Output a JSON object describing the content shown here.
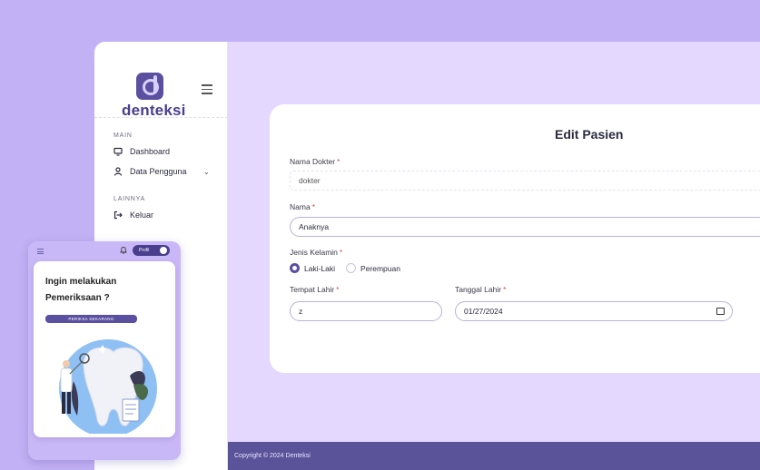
{
  "brand": {
    "name": "denteksi"
  },
  "sidebar": {
    "sections": [
      {
        "label": "MAIN"
      },
      {
        "label": "LAINNYA"
      }
    ],
    "items": [
      {
        "label": "Dashboard",
        "icon": "monitor-icon"
      },
      {
        "label": "Data Pengguna",
        "icon": "user-icon"
      },
      {
        "label": "Keluar",
        "icon": "logout-icon"
      }
    ]
  },
  "form": {
    "title": "Edit Pasien",
    "doctor_name": {
      "label": "Nama Dokter",
      "value": "dokter"
    },
    "name": {
      "label": "Nama",
      "value": "Anaknya"
    },
    "gender": {
      "label": "Jenis Kelamin",
      "options": [
        "Laki-Laki",
        "Perempuan"
      ],
      "selected": "Laki-Laki"
    },
    "birthplace": {
      "label": "Tempat Lahir",
      "value": "z"
    },
    "birthdate": {
      "label": "Tanggal Lahir",
      "value": "01/27/2024"
    },
    "required_mark": "*"
  },
  "footer": {
    "text": "Copyright © 2024 Denteksi"
  },
  "mobile": {
    "profile_label": "Profil",
    "promo_title": "Ingin melakukan Pemeriksaan ?",
    "promo_button": "PERIKSA SEKARANG"
  },
  "colors": {
    "accent": "#5b4fa0",
    "background": "#c3b1f5",
    "panel": "#e4d8ff",
    "footer": "#5b5399"
  }
}
